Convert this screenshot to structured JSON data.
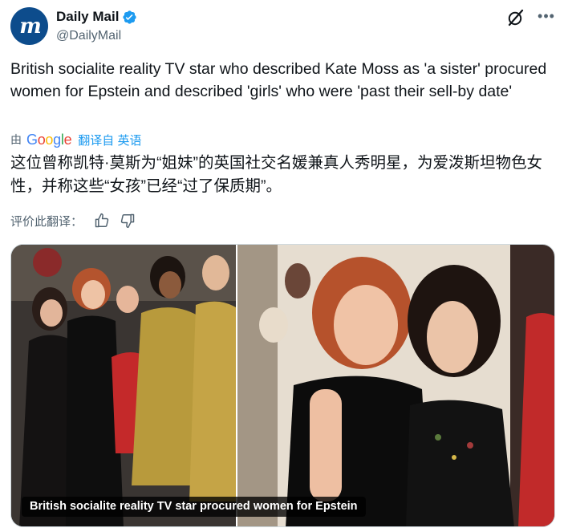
{
  "author": {
    "display_name": "Daily Mail",
    "handle": "@DailyMail",
    "avatar_letters": "m",
    "avatar_color": "#0d4c8c",
    "verified_color": "#1d9bf0"
  },
  "header_icons": [
    "grok-icon",
    "more-icon"
  ],
  "tweet": {
    "text": "British socialite reality TV star who described Kate Moss as 'a sister' procured women for Epstein and described 'girls' who were 'past their sell-by date'"
  },
  "translation": {
    "by_label": "由",
    "provider": "Google",
    "link_label": "翻译自 英语",
    "text": "这位曾称凯特·莫斯为“姐妹”的英国社交名媛兼真人秀明星，为爱泼斯坦物色女性，并称这些“女孩”已经“过了保质期”。",
    "rate_label": "评价此翻译："
  },
  "media": {
    "caption": "British socialite reality TV star procured women for Epstein"
  },
  "colors": {
    "text_primary": "#0f1419",
    "text_secondary": "#536471",
    "link": "#1d9bf0",
    "border": "#cfd9de"
  }
}
